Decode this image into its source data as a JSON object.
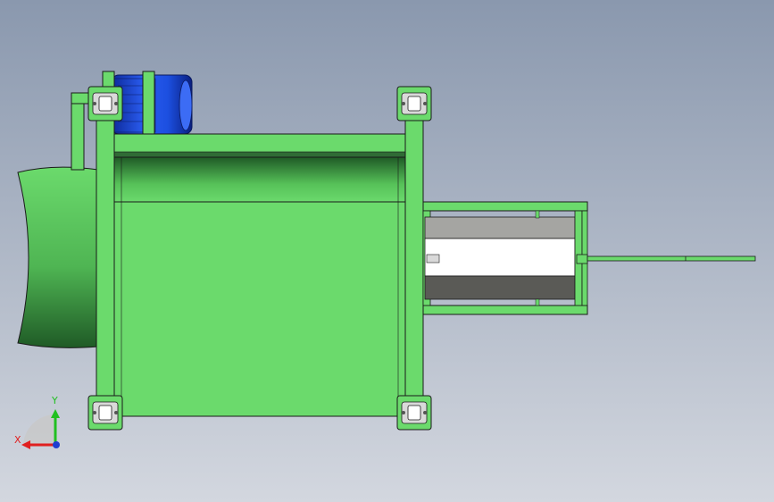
{
  "viewport": {
    "background_top": "#8a98ae",
    "background_bottom": "#d3d7df"
  },
  "model": {
    "body_color": "#6bda6c",
    "body_shadow_color": "#2f6b35",
    "outline_color": "#1a1a1a",
    "motor_color": "#1c4fe0",
    "motor_dark_color": "#0d2a9a",
    "bearing_color": "#d9d9d9",
    "rod_inner_colors": [
      "#a5a5a2",
      "#ffffff",
      "#5a5a56"
    ]
  },
  "triad": {
    "x_label": "X",
    "y_label": "Y",
    "x_color": "#e02020",
    "y_color": "#20c020",
    "z_color": "#1f3fd0"
  }
}
